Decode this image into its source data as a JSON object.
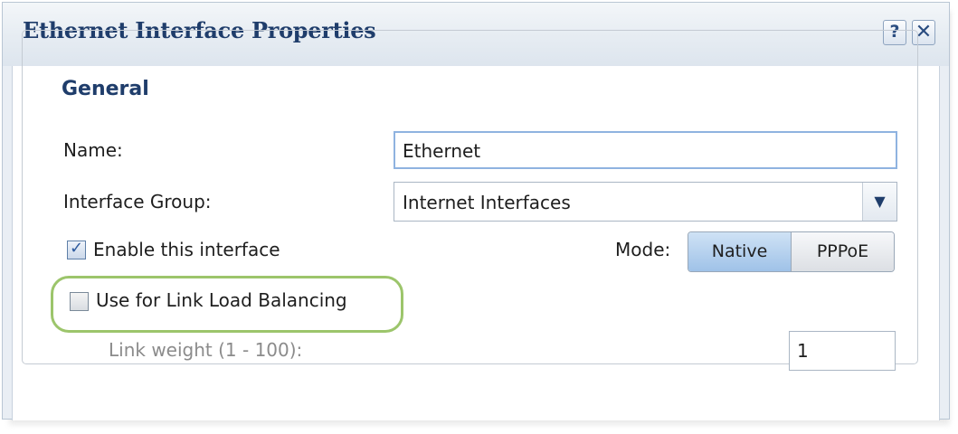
{
  "dialog": {
    "title": "Ethernet Interface Properties",
    "help_label": "?",
    "close_label": "✕"
  },
  "general": {
    "legend": "General",
    "name_label": "Name:",
    "name_value": "Ethernet",
    "group_label": "Interface Group:",
    "group_value": "Internet Interfaces",
    "enable_label": "Enable this interface",
    "enable_checked": true,
    "mode_label": "Mode:",
    "mode_options": [
      "Native",
      "PPPoE"
    ],
    "mode_selected": "Native",
    "lb_label": "Use for Link Load Balancing",
    "lb_checked": false,
    "weight_label": "Link weight (1 - 100):",
    "weight_value": "1"
  },
  "colors": {
    "title": "#1f3d6b",
    "highlight": "#9cc56b",
    "selected_segment": "#9fc2e8"
  }
}
